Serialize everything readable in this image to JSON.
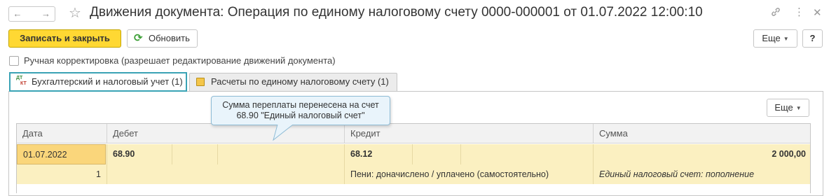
{
  "window": {
    "title": "Движения документа: Операция по единому налоговому счету 0000-000001 от 01.07.2022 12:00:10",
    "back": "←",
    "forward": "→",
    "star": "☆",
    "link_icon": "🔗",
    "menu_icon": "⋮",
    "close_icon": "✕"
  },
  "toolbar": {
    "save_close": "Записать и закрыть",
    "refresh": "Обновить",
    "refresh_icon": "C",
    "more": "Еще",
    "help": "?"
  },
  "manual_edit": {
    "label": "Ручная корректировка (разрешает редактирование движений документа)",
    "checked": false
  },
  "tabs": [
    {
      "label": "Бухгалтерский и налоговый учет (1)",
      "active": true,
      "icon": "dt-kt-icon"
    },
    {
      "label": "Расчеты по единому налоговому счету (1)",
      "active": false,
      "icon": "ledger-icon"
    }
  ],
  "inner": {
    "more": "Еще"
  },
  "tooltip": {
    "line1": "Сумма переплаты перенесена на счет",
    "line2": "68.90 \"Единый налоговый счет\""
  },
  "grid": {
    "headers": {
      "date": "Дата",
      "debit": "Дебет",
      "credit": "Кредит",
      "amount": "Сумма"
    },
    "row1": {
      "date": "01.07.2022",
      "debit": "68.90",
      "credit": "68.12",
      "amount": "2 000,00"
    },
    "row2": {
      "num": "1",
      "credit_sub": "Пени: доначислено / уплачено (самостоятельно)",
      "amount_sub": "Единый налоговый счет: пополнение"
    }
  },
  "colors": {
    "accent_yellow": "#ffd833",
    "row_highlight": "#fbf0c1",
    "active_tab_border": "#3aa3b5",
    "tooltip_bg": "#e9f4fb"
  }
}
